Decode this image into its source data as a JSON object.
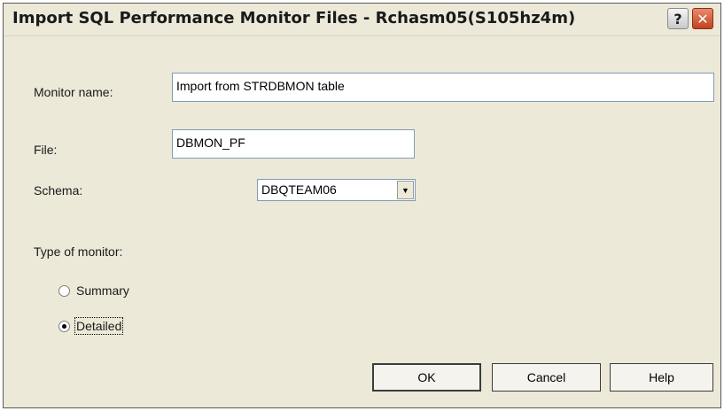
{
  "window": {
    "title": "Import SQL Performance Monitor Files - Rchasm05(S105hz4m)",
    "help_glyph": "?",
    "close_glyph": "✕"
  },
  "form": {
    "monitor_name_label": "Monitor name:",
    "monitor_name_value": "Import from STRDBMON table",
    "file_label": "File:",
    "file_value": "DBMON_PF",
    "schema_label": "Schema:",
    "schema_value": "DBQTEAM06",
    "type_label": "Type of monitor:",
    "options": [
      {
        "label": "Summary",
        "selected": false
      },
      {
        "label": "Detailed",
        "selected": true
      }
    ]
  },
  "buttons": {
    "ok": "OK",
    "cancel": "Cancel",
    "help": "Help"
  }
}
